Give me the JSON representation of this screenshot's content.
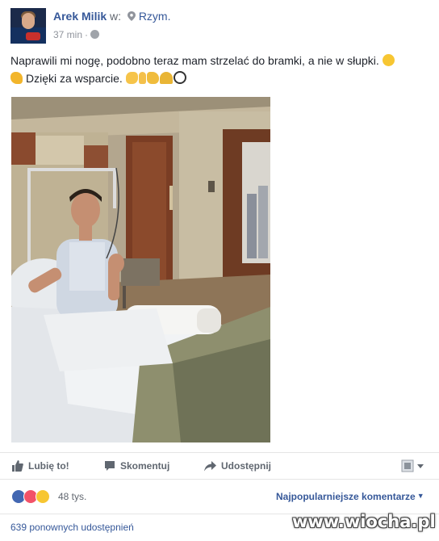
{
  "post": {
    "author": "Arek Milik",
    "at_word": "w:",
    "place": "Rzym.",
    "time": "37 min",
    "separator": "·",
    "text_line1": "Naprawili mi nogę, podobno teraz mam strzelać do bramki, a nie w słupki.",
    "text_line2": "Dzięki za wsparcie.",
    "icons": {
      "pin": "location-pin-icon",
      "privacy": "globe-icon"
    }
  },
  "actions": {
    "like_label": "Lubię to!",
    "comment_label": "Skomentuj",
    "share_label": "Udostępnij"
  },
  "reactions": {
    "count": "48 tys.",
    "sort_label": "Najpopularniejsze komentarze",
    "sort_caret": "▼",
    "types": [
      "like",
      "love",
      "sad"
    ]
  },
  "shares": {
    "label": "639 ponownych udostępnień"
  },
  "watermark": "www.wiocha.pl",
  "colors": {
    "link": "#365899",
    "muted": "#90949c",
    "like": "#4267b2",
    "love": "#f25268",
    "sad": "#f7c632"
  }
}
